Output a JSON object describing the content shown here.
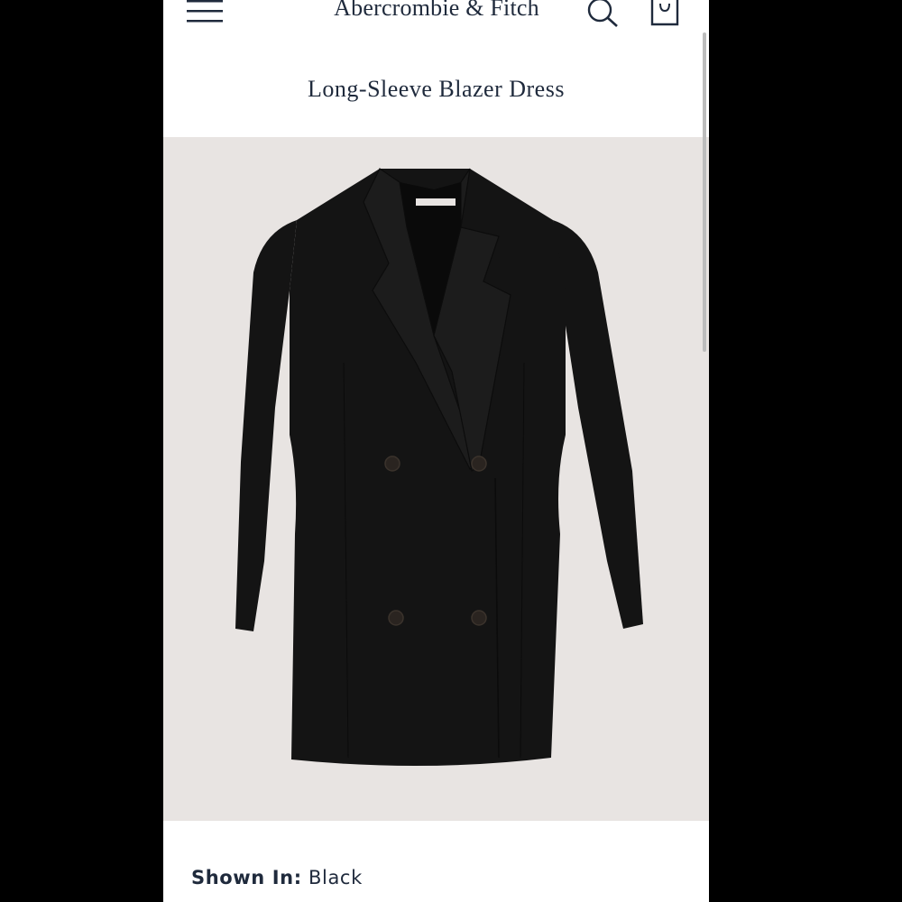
{
  "header": {
    "brand": "Abercrombie & Fitch",
    "icons": [
      "menu-icon",
      "search-icon",
      "shopping-bag-icon"
    ]
  },
  "product": {
    "title": "Long-Sleeve Blazer Dress",
    "image_alt": "Black long-sleeve double-breasted blazer dress",
    "colors": {
      "background": "#e8e4e2",
      "garment": "#141414"
    }
  },
  "shown_in": {
    "label": "Shown In:",
    "value": "Black"
  },
  "theme": {
    "text": "#1f2a3c",
    "outer": "#000000",
    "surface": "#ffffff"
  }
}
